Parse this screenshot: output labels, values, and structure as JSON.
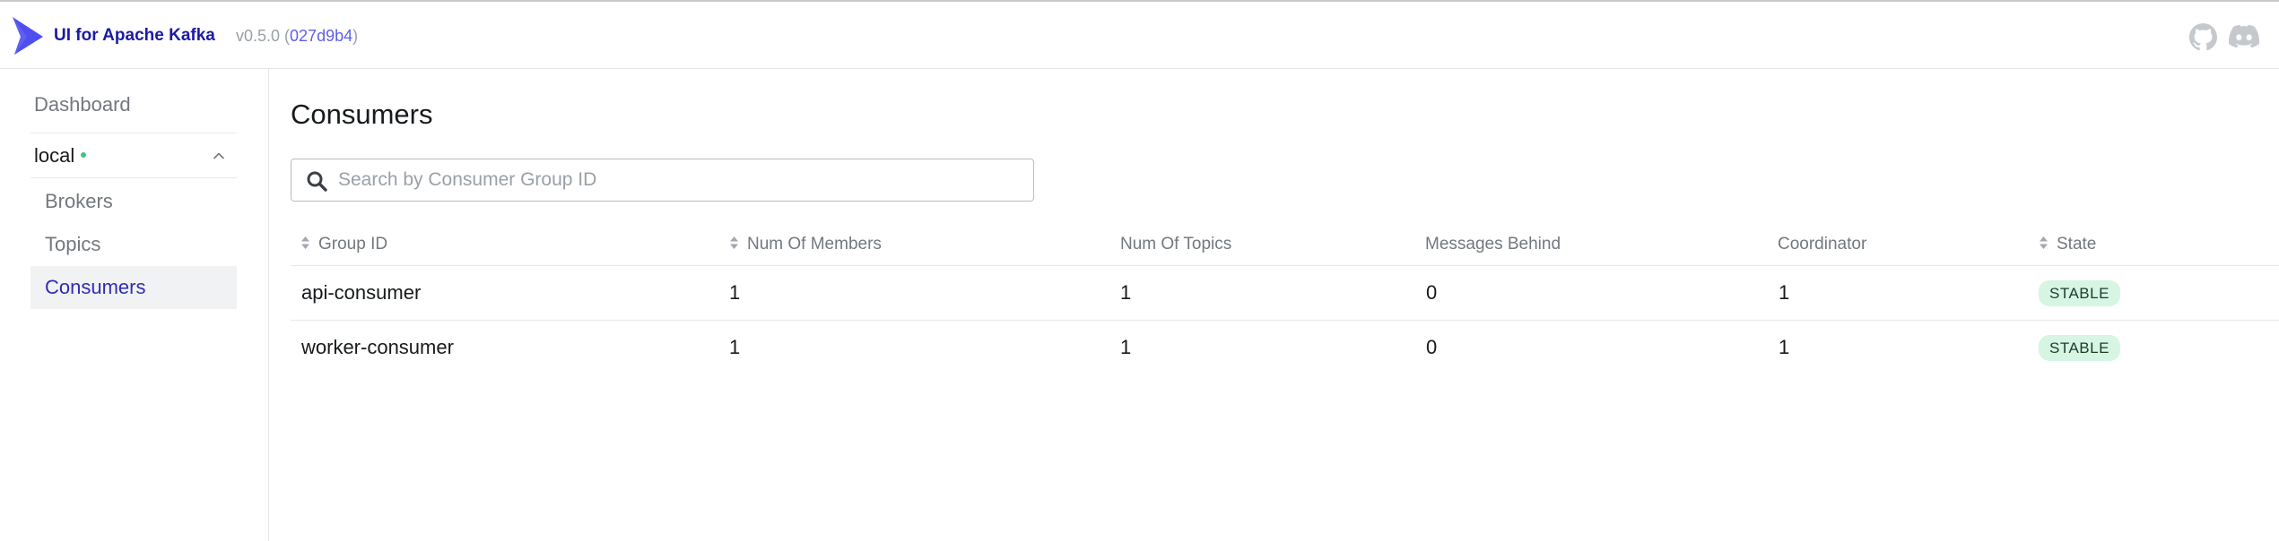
{
  "header": {
    "app_title": "UI for Apache Kafka",
    "version_prefix": "v0.5.0 (",
    "commit": "027d9b4",
    "version_suffix": ")",
    "icons": [
      "logo-icon",
      "github-icon",
      "discord-icon"
    ]
  },
  "sidebar": {
    "dashboard_label": "Dashboard",
    "cluster_name": "local",
    "cluster_status": "online",
    "items": [
      {
        "label": "Brokers",
        "active": false
      },
      {
        "label": "Topics",
        "active": false
      },
      {
        "label": "Consumers",
        "active": true
      }
    ]
  },
  "main": {
    "title": "Consumers",
    "search": {
      "placeholder": "Search by Consumer Group ID",
      "value": ""
    },
    "table": {
      "columns": [
        "Group ID",
        "Num Of Members",
        "Num Of Topics",
        "Messages Behind",
        "Coordinator",
        "State"
      ],
      "sortable_columns": [
        "Group ID",
        "Num Of Members",
        "State"
      ],
      "rows": [
        {
          "group_id": "api-consumer",
          "members": "1",
          "topics": "1",
          "messages_behind": "0",
          "coordinator": "1",
          "state": "STABLE"
        },
        {
          "group_id": "worker-consumer",
          "members": "1",
          "topics": "1",
          "messages_behind": "0",
          "coordinator": "1",
          "state": "STABLE"
        }
      ]
    }
  },
  "colors": {
    "brand": "#4f4ff0",
    "title_text": "#1b1aa6",
    "active_nav": "#2f2cb8",
    "active_nav_bg": "#f1f2f3",
    "status_online": "#3dc77a",
    "badge_bg": "#d6f5e3"
  }
}
